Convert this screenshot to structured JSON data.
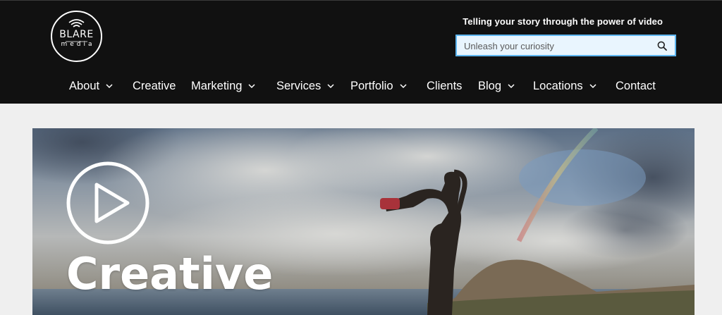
{
  "brand": {
    "wordmark": "BLARE",
    "sub": "media"
  },
  "header": {
    "tagline": "Telling your story through the power of video"
  },
  "search": {
    "placeholder": "Unleash your curiosity",
    "icon": "search-icon"
  },
  "nav": {
    "items": [
      {
        "label": "About",
        "dropdown": true
      },
      {
        "label": "Creative",
        "dropdown": false
      },
      {
        "label": "Marketing",
        "dropdown": true
      },
      {
        "label": "Services",
        "dropdown": true
      },
      {
        "label": "Portfolio",
        "dropdown": true
      },
      {
        "label": "Clients",
        "dropdown": false
      },
      {
        "label": "Blog",
        "dropdown": true
      },
      {
        "label": "Locations",
        "dropdown": true
      },
      {
        "label": "Contact",
        "dropdown": false
      }
    ]
  },
  "hero": {
    "title": "Creative",
    "play_icon": "play-circle-icon"
  },
  "colors": {
    "header_bg": "#111111",
    "page_bg": "#efefef",
    "search_bg": "#e9f5fe",
    "search_border": "#5db5f0",
    "text_light": "#ffffff"
  }
}
